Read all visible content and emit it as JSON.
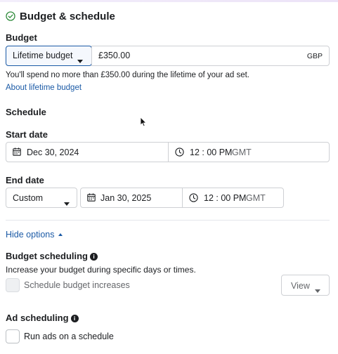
{
  "header": {
    "title": "Budget & schedule",
    "icon": "check-circle-icon"
  },
  "budget": {
    "label": "Budget",
    "type_selected": "Lifetime budget",
    "amount": "£350.00",
    "currency": "GBP",
    "hint": "You'll spend no more than £350.00 during the lifetime of your ad set.",
    "about_link": "About lifetime budget"
  },
  "schedule": {
    "label": "Schedule",
    "start": {
      "label": "Start date",
      "date": "Dec 30, 2024",
      "time": "12 : 00 PM",
      "tz": "GMT"
    },
    "end": {
      "label": "End date",
      "mode": "Custom",
      "date": "Jan 30, 2025",
      "time": "12 : 00 PM",
      "tz": "GMT"
    }
  },
  "options": {
    "toggle_label": "Hide options"
  },
  "budget_scheduling": {
    "label": "Budget scheduling",
    "description": "Increase your budget during specific days or times.",
    "checkbox_label": "Schedule budget increases",
    "view_label": "View"
  },
  "ad_scheduling": {
    "label": "Ad scheduling",
    "checkbox_label": "Run ads on a schedule"
  },
  "colors": {
    "accent": "#1b5aa6",
    "success": "#2e8b3a",
    "border": "#ced0d4"
  }
}
